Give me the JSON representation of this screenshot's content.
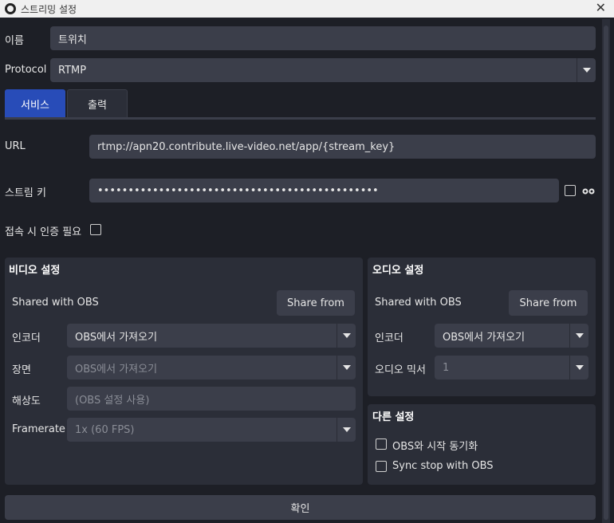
{
  "window": {
    "title": "스트리밍 설정",
    "close": "✕"
  },
  "name": {
    "label": "이름",
    "value": "트위치"
  },
  "protocol": {
    "label": "Protocol",
    "value": "RTMP"
  },
  "tabs": [
    {
      "label": "서비스"
    },
    {
      "label": "출력"
    }
  ],
  "url": {
    "label": "URL",
    "value": "rtmp://apn20.contribute.live-video.net/app/{stream_key}"
  },
  "stream_key": {
    "label": "스트림 키",
    "value": "••••••••••••••••••••••••••••••••••••••••••••••"
  },
  "auth": {
    "label": "접속 시 인증 필요"
  },
  "video": {
    "title": "비디오 설정",
    "shared_label": "Shared with OBS",
    "share_button": "Share from",
    "encoder": {
      "label": "인코더",
      "value": "OBS에서 가져오기"
    },
    "scene": {
      "label": "장면",
      "value": "OBS에서 가져오기"
    },
    "resolution": {
      "label": "해상도",
      "value": "(OBS 설정 사용)"
    },
    "framerate": {
      "label": "Framerate",
      "value": "1x (60 FPS)"
    }
  },
  "audio": {
    "title": "오디오 설정",
    "shared_label": "Shared with OBS",
    "share_button": "Share from",
    "encoder": {
      "label": "인코더",
      "value": "OBS에서 가져오기"
    },
    "mixer": {
      "label": "오디오 믹서",
      "value": "1"
    }
  },
  "other": {
    "title": "다른 설정",
    "sync_start": "OBS와 시작 동기화",
    "sync_stop": "Sync stop with OBS"
  },
  "confirm": "확인",
  "colors": {
    "accent": "#284cb8",
    "background": "#1d1f26",
    "panel": "#2b2e38",
    "field": "#3b3e4a"
  }
}
